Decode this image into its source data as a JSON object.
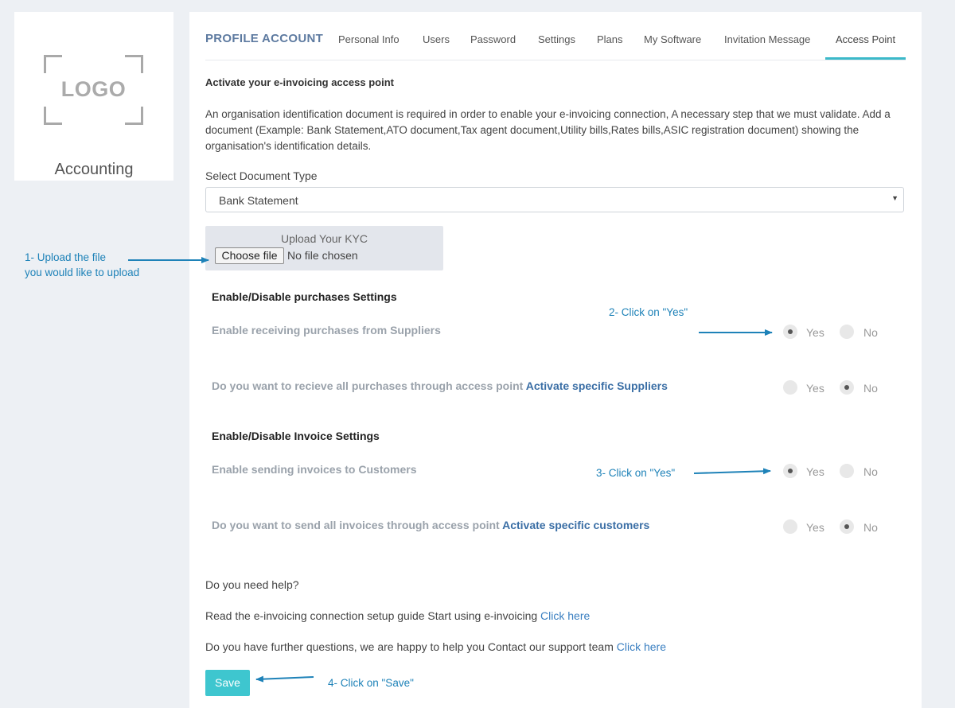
{
  "brand": {
    "logo_text": "LOGO",
    "company_name": "Accounting"
  },
  "tabs": {
    "title": "PROFILE ACCOUNT",
    "items": [
      {
        "label": "Personal Info"
      },
      {
        "label": "Users"
      },
      {
        "label": "Password"
      },
      {
        "label": "Settings"
      },
      {
        "label": "Plans"
      },
      {
        "label": "My Software"
      },
      {
        "label": "Invitation Message"
      },
      {
        "label": "Access Point",
        "active": true
      }
    ]
  },
  "access_point": {
    "heading": "Activate your e-invoicing access point",
    "description": "An organisation identification document is required in order to enable your e-invoicing connection, A necessary step that we must validate. Add a document (Example: Bank Statement,ATO document,Tax agent document,Utility bills,Rates bills,ASIC registration document) showing the organisation's identification details.",
    "doc_type_label": "Select Document Type",
    "doc_type_value": "Bank Statement",
    "upload": {
      "title": "Upload Your KYC",
      "button_label": "Choose file",
      "status": "No file chosen"
    }
  },
  "purchases": {
    "title": "Enable/Disable purchases Settings",
    "settings": [
      {
        "label": "Enable receiving purchases from Suppliers",
        "link": "",
        "selected": "Yes"
      },
      {
        "label": "Do you want to recieve all purchases through access point",
        "link": "Activate specific Suppliers",
        "selected": "No"
      }
    ]
  },
  "invoices": {
    "title": "Enable/Disable Invoice Settings",
    "settings": [
      {
        "label": "Enable sending invoices to Customers",
        "link": "",
        "selected": "Yes"
      },
      {
        "label": "Do you want to send all invoices through access point",
        "link": "Activate specific customers",
        "selected": "No"
      }
    ]
  },
  "radio_labels": {
    "yes": "Yes",
    "no": "No"
  },
  "help": {
    "question": "Do you need help?",
    "guide_text": "Read the e-invoicing connection setup guide Start using e-invoicing",
    "guide_link": "Click here",
    "support_text": "Do you have further questions, we are happy to help you Contact our support team",
    "support_link": "Click here"
  },
  "actions": {
    "save_label": "Save"
  },
  "annotations": {
    "step1_line1": "1- Upload the file",
    "step1_line2": "you would like to upload",
    "step2": "2- Click on \"Yes\"",
    "step3": "3- Click on \"Yes\"",
    "step4": "4- Click on \"Save\""
  },
  "colors": {
    "accent": "#3bb9c9",
    "save_button": "#3ec6cf",
    "annotation": "#1e82b8",
    "link": "#3a6ea5"
  }
}
